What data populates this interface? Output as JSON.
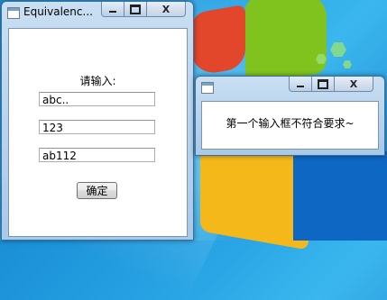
{
  "main_window": {
    "title": "Equivalenc..."
  },
  "form": {
    "prompt": "请输入:",
    "field1": "abc..",
    "field2": "123",
    "field3": "ab112",
    "ok_label": "确定"
  },
  "message_window": {
    "title": "",
    "message": "第一个输入框不符合要求~"
  },
  "window_controls": {
    "close_glyph": "X"
  }
}
